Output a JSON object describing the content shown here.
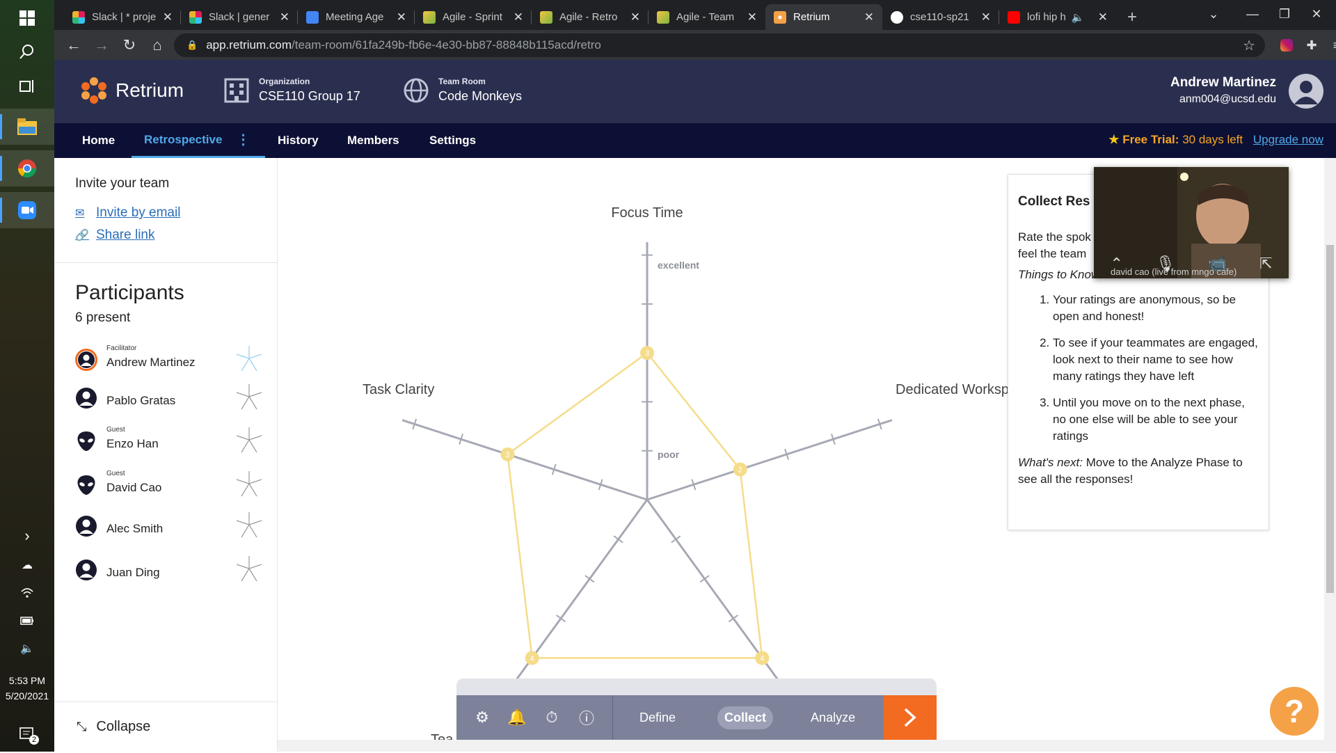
{
  "os": {
    "clock_time": "5:53 PM",
    "clock_date": "5/20/2021",
    "notification_count": "2"
  },
  "browser": {
    "tabs": [
      {
        "title": "Slack | * proje",
        "active": false
      },
      {
        "title": "Slack | gener",
        "active": false
      },
      {
        "title": "Meeting Age",
        "active": false
      },
      {
        "title": "Agile - Sprint",
        "active": false
      },
      {
        "title": "Agile - Retro",
        "active": false
      },
      {
        "title": "Agile - Team",
        "active": false
      },
      {
        "title": "Retrium",
        "active": true
      },
      {
        "title": "cse110-sp21",
        "active": false
      },
      {
        "title": "lofi hip h",
        "active": false
      }
    ],
    "url_host": "app.retrium.com",
    "url_path": "/team-room/61fa249b-fb6e-4e30-bb87-88848b115acd/retro",
    "profile_initial": "a"
  },
  "header": {
    "brand": "Retrium",
    "org_label": "Organization",
    "org_value": "CSE110 Group 17",
    "room_label": "Team Room",
    "room_value": "Code Monkeys",
    "user_name": "Andrew Martinez",
    "user_email": "anm004@ucsd.edu"
  },
  "nav": {
    "items": [
      "Home",
      "Retrospective",
      "History",
      "Members",
      "Settings"
    ],
    "active": "Retrospective",
    "trial_prefix": "Free Trial:",
    "trial_rest": "30 days left",
    "upgrade": "Upgrade now"
  },
  "sidebar": {
    "invite_title": "Invite your team",
    "invite_email": "Invite by email",
    "share_link": "Share link",
    "participants_title": "Participants",
    "present": "6 present",
    "participants": [
      {
        "name": "Andrew Martinez",
        "role": "Facilitator"
      },
      {
        "name": "Pablo Gratas",
        "role": ""
      },
      {
        "name": "Enzo Han",
        "role": "Guest"
      },
      {
        "name": "David Cao",
        "role": "Guest"
      },
      {
        "name": "Alec Smith",
        "role": ""
      },
      {
        "name": "Juan Ding",
        "role": ""
      }
    ],
    "collapse": "Collapse"
  },
  "radar": {
    "axes": [
      "Focus Time",
      "Dedicated Workspace",
      "",
      "",
      "Task Clarity"
    ],
    "scale_top": "excellent",
    "scale_low": "poor",
    "ratings": [
      3,
      2,
      4,
      4,
      3
    ],
    "bottom_partial": "Tea"
  },
  "info_panel": {
    "title": "Collect Res",
    "intro": "Rate the spok",
    "intro2": "feel the team",
    "things": "Things to Know:",
    "items": [
      "Your ratings are anonymous, so be open and honest!",
      "To see if your teammates are engaged, look next to their name to see how many ratings they have left",
      "Until you move on to the next phase, no one else will be able to see your ratings"
    ],
    "next_label": "What's next:",
    "next_text": "Move to the Analyze Phase to see all the responses!"
  },
  "video": {
    "caption": "david cao (live from mngo cafe)"
  },
  "toolbar": {
    "phases": [
      "Define",
      "Collect",
      "Analyze"
    ],
    "active_phase": "Collect"
  },
  "colors": {
    "header_bg": "#2b2f4f",
    "nav_bg": "#0d1035",
    "accent_blue": "#4fa9e8",
    "orange": "#f26b21",
    "radar_line": "#f5dc8a"
  }
}
